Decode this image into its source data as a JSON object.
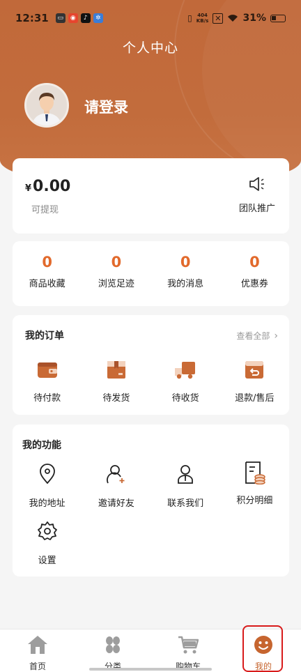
{
  "status_bar": {
    "time": "12:31",
    "net_speed_value": "404",
    "net_speed_unit": "KB/s",
    "battery": "31%"
  },
  "header": {
    "title": "个人中心",
    "login_prompt": "请登录"
  },
  "balance": {
    "currency": "¥",
    "amount": "0.00",
    "label": "可提现",
    "promo_label": "团队推广"
  },
  "stats": [
    {
      "value": "0",
      "label": "商品收藏"
    },
    {
      "value": "0",
      "label": "浏览足迹"
    },
    {
      "value": "0",
      "label": "我的消息"
    },
    {
      "value": "0",
      "label": "优惠券"
    }
  ],
  "orders": {
    "title": "我的订单",
    "view_all": "查看全部",
    "items": [
      {
        "label": "待付款",
        "icon": "wallet-icon"
      },
      {
        "label": "待发货",
        "icon": "package-icon"
      },
      {
        "label": "待收货",
        "icon": "truck-icon"
      },
      {
        "label": "退款/售后",
        "icon": "return-box-icon"
      }
    ]
  },
  "functions": {
    "title": "我的功能",
    "items": [
      {
        "label": "我的地址",
        "icon": "location-pin-icon"
      },
      {
        "label": "邀请好友",
        "icon": "add-user-icon"
      },
      {
        "label": "联系我们",
        "icon": "contact-person-icon"
      },
      {
        "label": "积分明细",
        "icon": "points-document-icon"
      },
      {
        "label": "设置",
        "icon": "gear-icon"
      }
    ]
  },
  "tabbar": {
    "items": [
      {
        "label": "首页",
        "icon": "home-icon"
      },
      {
        "label": "分类",
        "icon": "category-icon"
      },
      {
        "label": "购物车",
        "icon": "cart-icon"
      },
      {
        "label": "我的",
        "icon": "smiley-profile-icon"
      }
    ],
    "active_index": 3
  },
  "colors": {
    "header": "#c1693a",
    "accent": "#e26a2c",
    "active_tab": "#c6652f",
    "highlight_box": "#d81b1b"
  }
}
